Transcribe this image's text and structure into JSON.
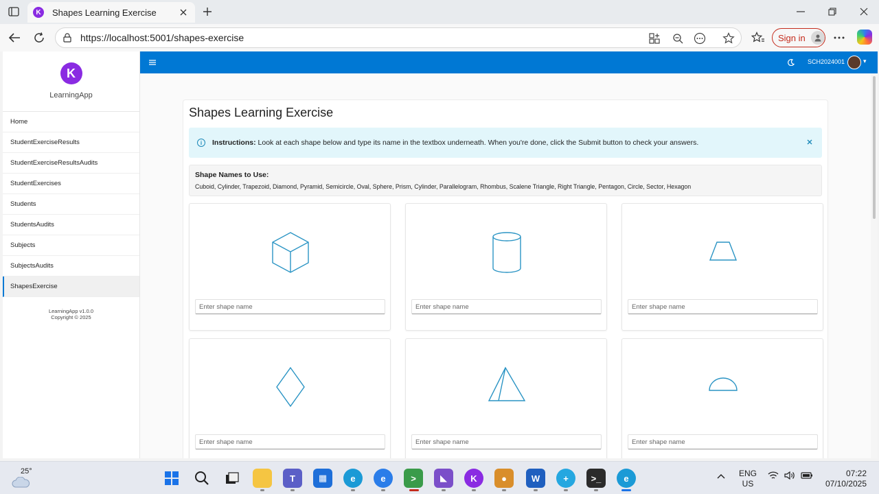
{
  "browser": {
    "tab_title": "Shapes Learning Exercise",
    "url": "https://localhost:5001/shapes-exercise",
    "signin_label": "Sign in"
  },
  "sidebar": {
    "brand": "LearningApp",
    "items": [
      {
        "label": "Home"
      },
      {
        "label": "StudentExerciseResults"
      },
      {
        "label": "StudentExerciseResultsAudits"
      },
      {
        "label": "StudentExercises"
      },
      {
        "label": "Students"
      },
      {
        "label": "StudentsAudits"
      },
      {
        "label": "Subjects"
      },
      {
        "label": "SubjectsAudits"
      },
      {
        "label": "ShapesExercise",
        "active": true
      }
    ],
    "footer_version": "LearningApp v1.0.0",
    "footer_copyright": "Copyright © 2025"
  },
  "topbar": {
    "user_code": "SCH2024001",
    "accent": "#0078d4"
  },
  "main": {
    "title": "Shapes Learning Exercise",
    "instructions_label": "Instructions:",
    "instructions_text": " Look at each shape below and type its name in the textbox underneath. When you're done, click the Submit button to check your answers.",
    "names_title": "Shape Names to Use:",
    "names_list": "Cuboid, Cylinder, Trapezoid, Diamond, Pyramid, Semicircle, Oval, Sphere, Prism, Cylinder, Parallelogram, Rhombus, Scalene Triangle, Right Triangle, Pentagon, Circle, Sector, Hexagon",
    "input_placeholder": "Enter shape name",
    "shape_color": "#2a94c4",
    "shapes": [
      {
        "icon": "cuboid-shape-icon"
      },
      {
        "icon": "cylinder-shape-icon"
      },
      {
        "icon": "trapezoid-shape-icon"
      },
      {
        "icon": "diamond-shape-icon"
      },
      {
        "icon": "pyramid-shape-icon"
      },
      {
        "icon": "semicircle-shape-icon"
      }
    ]
  },
  "taskbar": {
    "temperature": "25°",
    "lang_line1": "ENG",
    "lang_line2": "US",
    "time": "07:22",
    "date": "07/10/2025"
  }
}
